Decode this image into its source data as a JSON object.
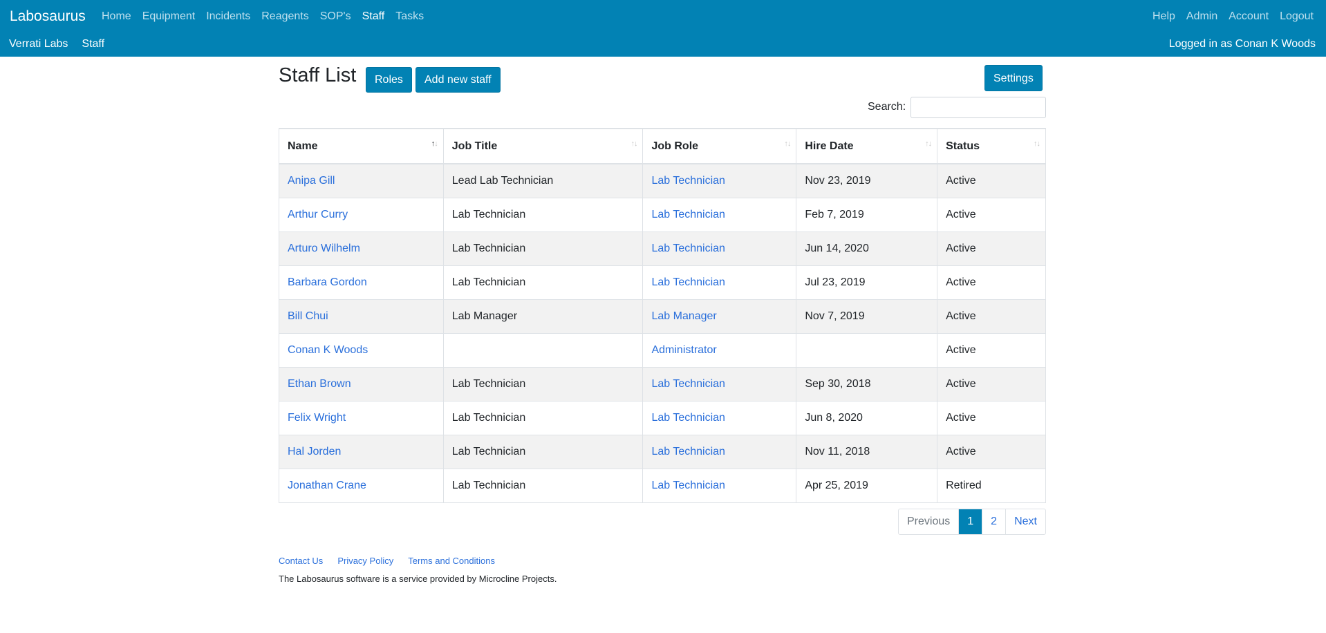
{
  "navbar": {
    "brand": "Labosaurus",
    "left_items": [
      {
        "label": "Home",
        "active": false
      },
      {
        "label": "Equipment",
        "active": false
      },
      {
        "label": "Incidents",
        "active": false
      },
      {
        "label": "Reagents",
        "active": false
      },
      {
        "label": "SOP's",
        "active": false
      },
      {
        "label": "Staff",
        "active": true
      },
      {
        "label": "Tasks",
        "active": false
      }
    ],
    "right_items": [
      "Help",
      "Admin",
      "Account",
      "Logout"
    ],
    "sub_left": [
      "Verrati Labs",
      "Staff"
    ],
    "logged_in": "Logged in as Conan K Woods"
  },
  "page": {
    "title": "Staff List",
    "roles_button": "Roles",
    "add_button": "Add new staff",
    "settings_button": "Settings",
    "search_label": "Search:"
  },
  "table": {
    "headers": [
      "Name",
      "Job Title",
      "Job Role",
      "Hire Date",
      "Status"
    ],
    "sorted_column": "Name",
    "rows": [
      {
        "name": "Anipa Gill",
        "job_title": "Lead Lab Technician",
        "job_role": "Lab Technician",
        "hire_date": "Nov 23, 2019",
        "status": "Active"
      },
      {
        "name": "Arthur Curry",
        "job_title": "Lab Technician",
        "job_role": "Lab Technician",
        "hire_date": "Feb 7, 2019",
        "status": "Active"
      },
      {
        "name": "Arturo Wilhelm",
        "job_title": "Lab Technician",
        "job_role": "Lab Technician",
        "hire_date": "Jun 14, 2020",
        "status": "Active"
      },
      {
        "name": "Barbara Gordon",
        "job_title": "Lab Technician",
        "job_role": "Lab Technician",
        "hire_date": "Jul 23, 2019",
        "status": "Active"
      },
      {
        "name": "Bill Chui",
        "job_title": "Lab Manager",
        "job_role": "Lab Manager",
        "hire_date": "Nov 7, 2019",
        "status": "Active"
      },
      {
        "name": "Conan K Woods",
        "job_title": "",
        "job_role": "Administrator",
        "hire_date": "",
        "status": "Active"
      },
      {
        "name": "Ethan Brown",
        "job_title": "Lab Technician",
        "job_role": "Lab Technician",
        "hire_date": "Sep 30, 2018",
        "status": "Active"
      },
      {
        "name": "Felix Wright",
        "job_title": "Lab Technician",
        "job_role": "Lab Technician",
        "hire_date": "Jun 8, 2020",
        "status": "Active"
      },
      {
        "name": "Hal Jorden",
        "job_title": "Lab Technician",
        "job_role": "Lab Technician",
        "hire_date": "Nov 11, 2018",
        "status": "Active"
      },
      {
        "name": "Jonathan Crane",
        "job_title": "Lab Technician",
        "job_role": "Lab Technician",
        "hire_date": "Apr 25, 2019",
        "status": "Retired"
      }
    ]
  },
  "pagination": {
    "previous": "Previous",
    "pages": [
      "1",
      "2"
    ],
    "current": "1",
    "next": "Next"
  },
  "footer": {
    "links": [
      "Contact Us",
      "Privacy Policy",
      "Terms and Conditions"
    ],
    "note": "The Labosaurus software is a service provided by Microcline Projects."
  },
  "colors": {
    "primary": "#0282b4",
    "link": "#2a6fdb",
    "nav_inactive": "#bfe0ee",
    "stripe": "#f2f2f2"
  }
}
